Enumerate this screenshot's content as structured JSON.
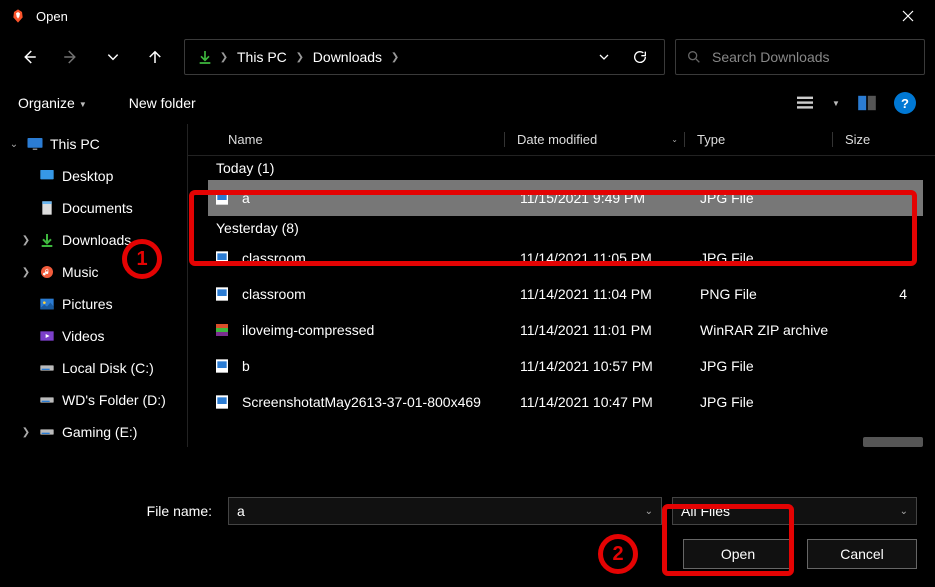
{
  "window": {
    "title": "Open"
  },
  "breadcrumb": {
    "items": [
      "This PC",
      "Downloads"
    ]
  },
  "search": {
    "placeholder": "Search Downloads"
  },
  "toolbar": {
    "organize": "Organize",
    "new_folder": "New folder"
  },
  "tree": {
    "root": {
      "label": "This PC"
    },
    "children": [
      {
        "label": "Desktop"
      },
      {
        "label": "Documents"
      },
      {
        "label": "Downloads"
      },
      {
        "label": "Music"
      },
      {
        "label": "Pictures"
      },
      {
        "label": "Videos"
      },
      {
        "label": "Local Disk (C:)"
      },
      {
        "label": "WD's Folder (D:)"
      },
      {
        "label": "Gaming (E:)"
      }
    ]
  },
  "columns": {
    "name": "Name",
    "date": "Date modified",
    "type": "Type",
    "size": "Size"
  },
  "groups": {
    "today": "Today (1)",
    "yesterday": "Yesterday (8)"
  },
  "files": {
    "today": [
      {
        "name": "a",
        "date": "11/15/2021 9:49 PM",
        "type": "JPG File",
        "size": "",
        "icon": "image"
      }
    ],
    "yesterday": [
      {
        "name": "classroom",
        "date": "11/14/2021 11:05 PM",
        "type": "JPG File",
        "size": "",
        "icon": "image"
      },
      {
        "name": "classroom",
        "date": "11/14/2021 11:04 PM",
        "type": "PNG File",
        "size": "4",
        "icon": "image"
      },
      {
        "name": "iloveimg-compressed",
        "date": "11/14/2021 11:01 PM",
        "type": "WinRAR ZIP archive",
        "size": "",
        "icon": "zip"
      },
      {
        "name": "b",
        "date": "11/14/2021 10:57 PM",
        "type": "JPG File",
        "size": "",
        "icon": "image"
      },
      {
        "name": "ScreenshotatMay2613-37-01-800x469",
        "date": "11/14/2021 10:47 PM",
        "type": "JPG File",
        "size": "",
        "icon": "image"
      }
    ]
  },
  "footer": {
    "filename_label": "File name:",
    "filename_value": "a",
    "filter_value": "All Files",
    "open": "Open",
    "cancel": "Cancel"
  },
  "annotations": {
    "one": "1",
    "two": "2"
  }
}
